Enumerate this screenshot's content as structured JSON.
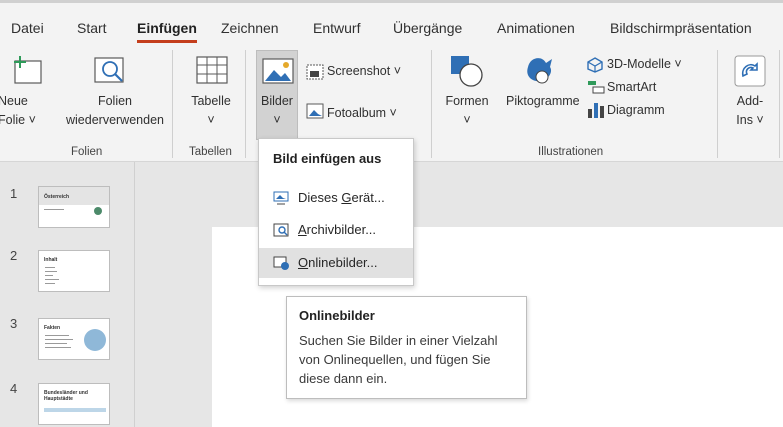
{
  "tabs": [
    "Datei",
    "Start",
    "Einfügen",
    "Zeichnen",
    "Entwurf",
    "Übergänge",
    "Animationen",
    "Bildschirmpräsentation"
  ],
  "active_tab": "Einfügen",
  "ribbon": {
    "folien": {
      "neue_folie_line1": "Neue",
      "neue_folie_line2": "Folie ˅",
      "wieder_line1": "Folien",
      "wieder_line2": "wiederverwenden",
      "group_label": "Folien"
    },
    "tabellen": {
      "tabelle": "Tabelle",
      "group_label": "Tabellen"
    },
    "bilder": {
      "bilder": "Bilder",
      "screenshot": "Screenshot ˅",
      "fotoalbum": "Fotoalbum ˅"
    },
    "illustrationen": {
      "formen": "Formen",
      "piktogramme": "Piktogramme",
      "modelle": "3D-Modelle ˅",
      "smartart": "SmartArt",
      "diagramm": "Diagramm",
      "group_label": "Illustrationen"
    },
    "addins": {
      "line1": "Add-",
      "line2": "Ins ˅"
    },
    "accent_color": "#c43e1c"
  },
  "dropdown": {
    "header": "Bild einfügen aus",
    "items": [
      {
        "label": "Dieses Gerät...",
        "underline": "G"
      },
      {
        "label": "Archivbilder...",
        "underline": "A"
      },
      {
        "label": "Onlinebilder...",
        "underline": "O"
      }
    ],
    "hovered_index": 2
  },
  "tooltip": {
    "title": "Onlinebilder",
    "body": "Suchen Sie Bilder in einer Vielzahl von Onlinequellen, und fügen Sie diese dann ein."
  },
  "slides": [
    {
      "number": "1",
      "title": "Österreich"
    },
    {
      "number": "2",
      "title": "Inhalt"
    },
    {
      "number": "3",
      "title": "Fakten"
    },
    {
      "number": "4",
      "title": "Bundesländer und Hauptstädte"
    }
  ]
}
